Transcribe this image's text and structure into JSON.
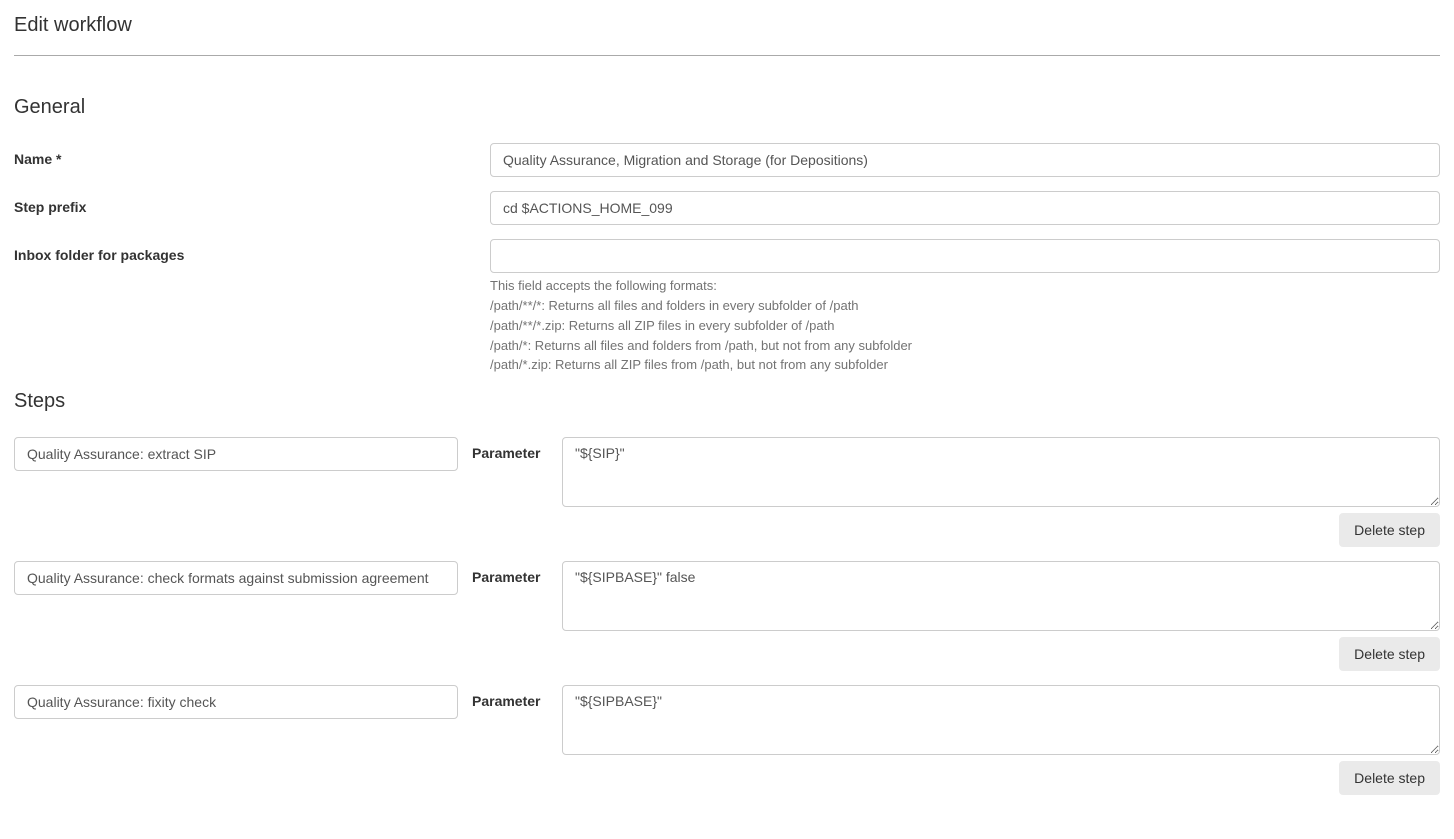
{
  "page": {
    "title": "Edit workflow"
  },
  "general": {
    "heading": "General",
    "name_label": "Name *",
    "name_value": "Quality Assurance, Migration and Storage (for Depositions)",
    "step_prefix_label": "Step prefix",
    "step_prefix_value": "cd $ACTIONS_HOME_099",
    "inbox_label": "Inbox folder for packages",
    "inbox_value": "",
    "inbox_help": {
      "line1": "This field accepts the following formats:",
      "line2": "/path/**/*: Returns all files and folders in every subfolder of /path",
      "line3": "/path/**/*.zip: Returns all ZIP files in every subfolder of /path",
      "line4": "/path/*: Returns all files and folders from /path, but not from any subfolder",
      "line5": "/path/*.zip: Returns all ZIP files from /path, but not from any subfolder"
    }
  },
  "steps": {
    "heading": "Steps",
    "parameter_label": "Parameter",
    "delete_label": "Delete step",
    "items": [
      {
        "name": "Quality Assurance: extract SIP",
        "parameter": "\"${SIP}\""
      },
      {
        "name": "Quality Assurance: check formats against submission agreement",
        "parameter": "\"${SIPBASE}\" false"
      },
      {
        "name": "Quality Assurance: fixity check",
        "parameter": "\"${SIPBASE}\""
      }
    ]
  }
}
